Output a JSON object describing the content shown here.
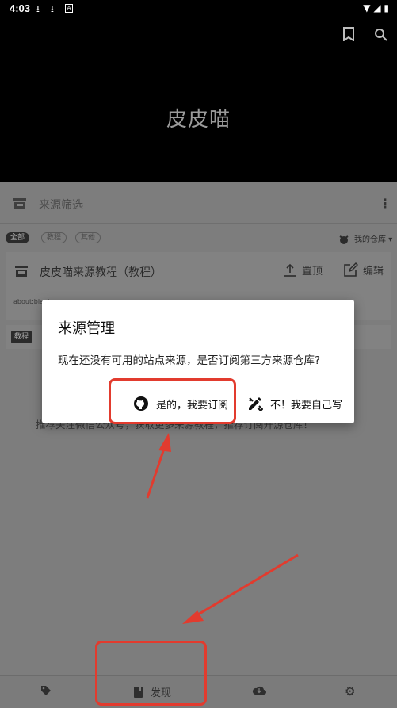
{
  "status_bar": {
    "time": "4:03"
  },
  "app": {
    "title": "皮皮喵"
  },
  "filter_bar": {
    "label": "来源筛选"
  },
  "chips": [
    "全部",
    "教程",
    "其他"
  ],
  "repo_button": {
    "label": "我的仓库"
  },
  "source_item": {
    "name": "皮皮喵来源教程（教程）",
    "pin_label": "置顶",
    "edit_label": "编辑",
    "url_partial": "about:blank",
    "tag": "教程"
  },
  "background_hint": "推荐关注微信公众号，获取更多来源教程，推荐订阅开源仓库！",
  "dialog": {
    "title": "来源管理",
    "message": "现在还没有可用的站点来源，是否订阅第三方来源仓库?",
    "confirm_label": "是的，我要订阅",
    "decline_label": "不！我要自己写"
  },
  "bottom_nav": {
    "discover_label": "发现"
  },
  "colors": {
    "annotation_red": "#e23b2e",
    "header_bg": "#000000",
    "dialog_bg": "#ffffff"
  }
}
